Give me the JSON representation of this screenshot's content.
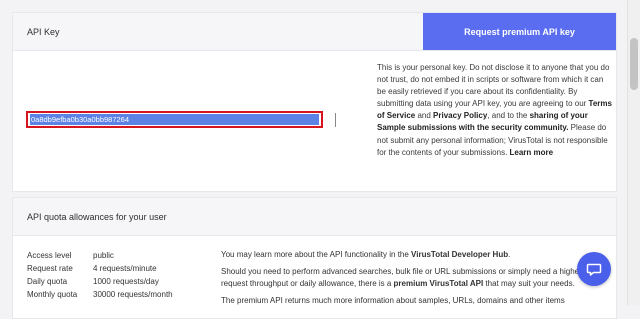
{
  "api_key_panel": {
    "title": "API Key",
    "premium_button": "Request premium API key",
    "key_value": "0a8db9efba0b30a0bb987264",
    "description": {
      "t1": "This is your personal key. Do not disclose it to anyone that you do not trust, do not embed it in scripts or software from which it can be easily retrieved if you care about its confidentiality. By submitting data using your API key, you are agreeing to our ",
      "terms": "Terms of Service",
      "t2": " and ",
      "privacy": "Privacy Policy",
      "t3": ", and to the ",
      "sharing": "sharing of your Sample submissions with the security community.",
      "t4": " Please do not submit any personal information; VirusTotal is not responsible for the contents of your submissions. ",
      "learn_more": "Learn more"
    }
  },
  "quota_panel": {
    "title": "API quota allowances for your user",
    "rows": [
      {
        "label": "Access level",
        "value": "public"
      },
      {
        "label": "Request rate",
        "value": "4 requests/minute"
      },
      {
        "label": "Daily quota",
        "value": "1000 requests/day"
      },
      {
        "label": "Monthly quota",
        "value": "30000 requests/month"
      }
    ],
    "info": {
      "p1_text": "You may learn more about the API functionality in the ",
      "p1_link": "VirusTotal Developer Hub",
      "p1_end": ".",
      "p2_text": "Should you need to perform advanced searches, bulk file or URL submissions or simply need a higher request throughput or daily allowance, there is a ",
      "p2_bold": "premium VirusTotal API",
      "p2_end": " that may suit your needs.",
      "p3_text": "The premium API returns much more information about samples, URLs, domains and other items"
    }
  },
  "chat": {
    "icon": "chat-bubble-icon"
  },
  "colors": {
    "accent": "#5a6df0",
    "highlight_border": "#d6141e",
    "selection": "#5c82e6"
  }
}
